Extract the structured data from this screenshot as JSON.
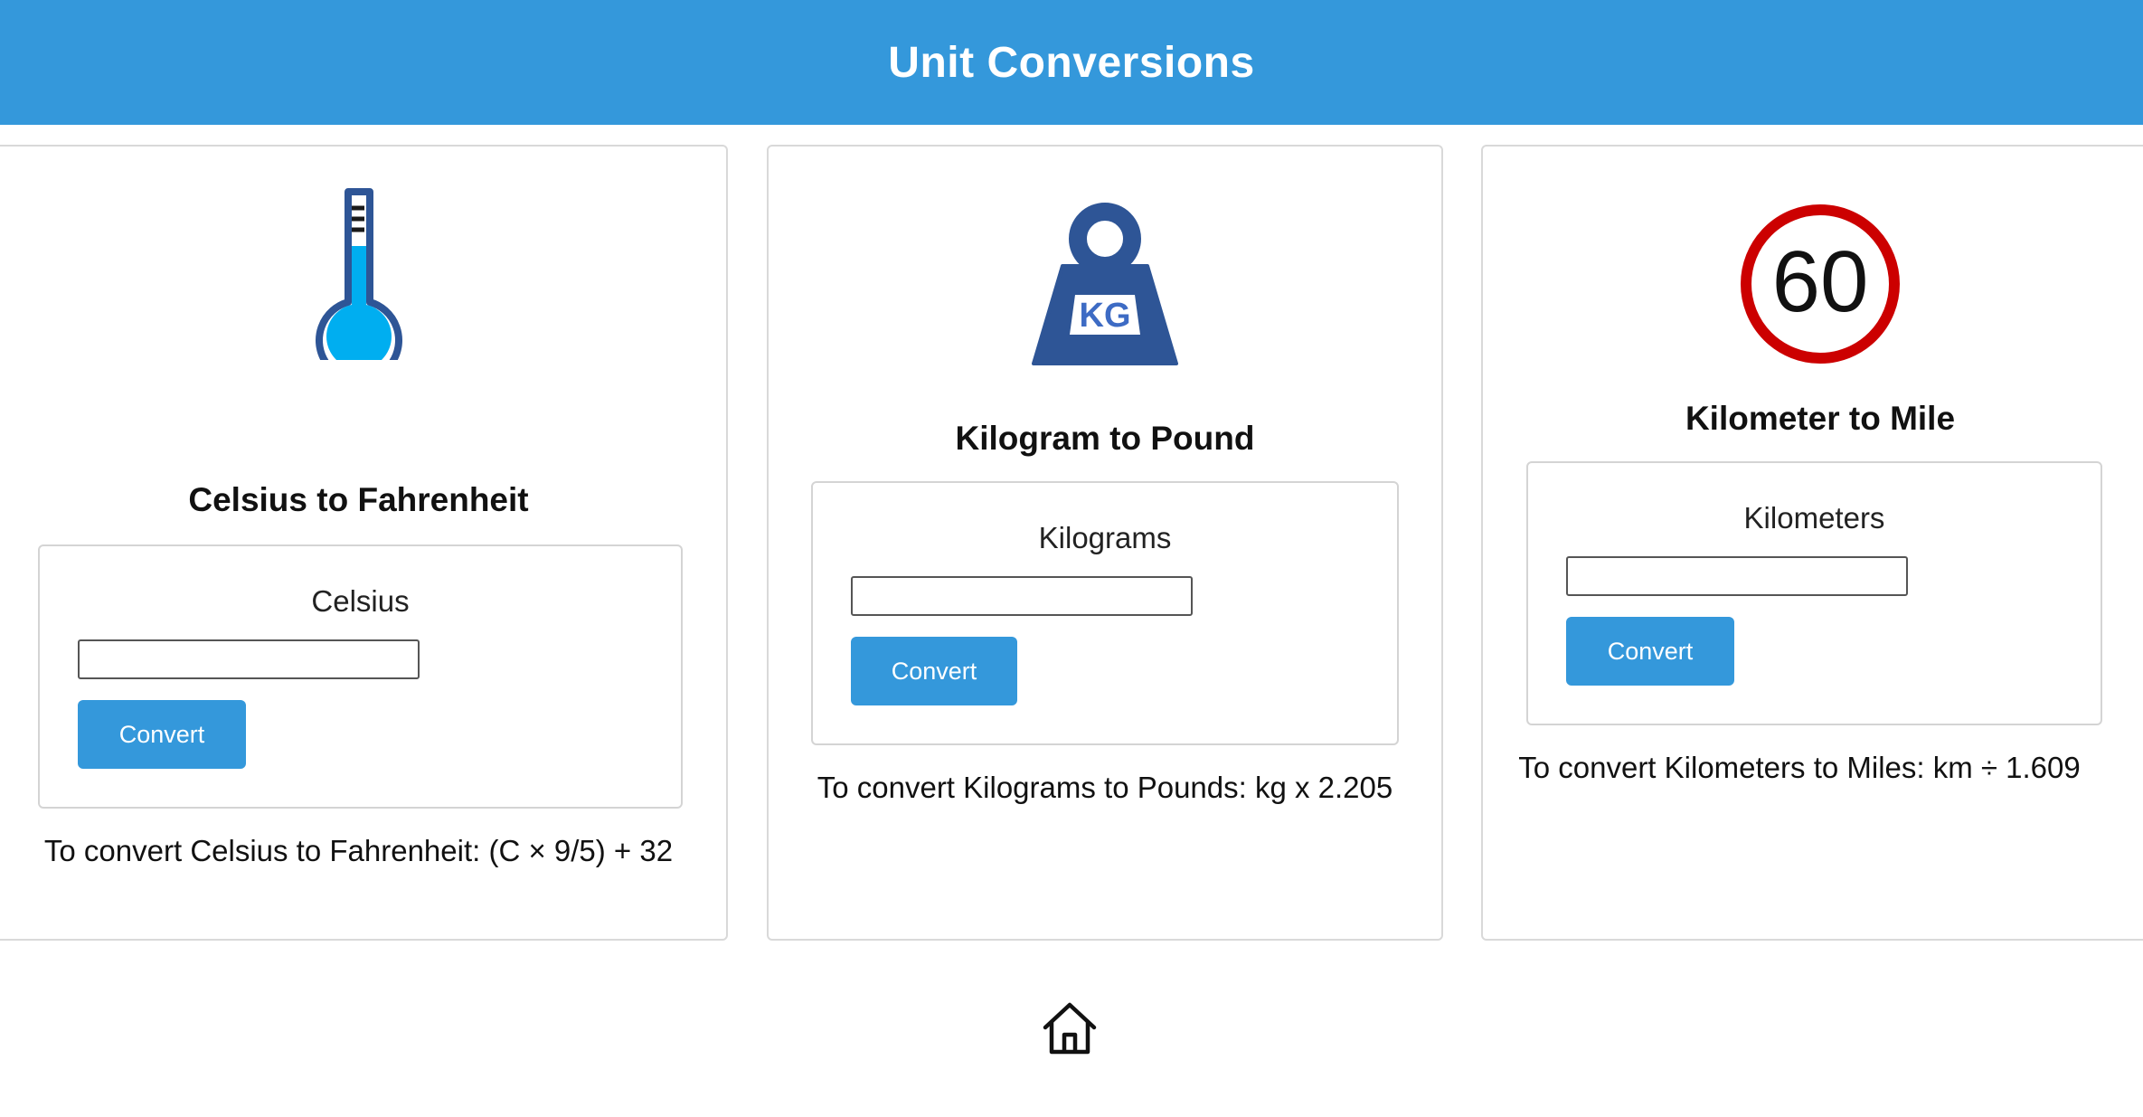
{
  "header": {
    "title": "Unit Conversions",
    "background_color": "#3498db"
  },
  "cards": [
    {
      "icon": "thermometer-icon",
      "title": "Celsius to Fahrenheit",
      "field_label": "Celsius",
      "input_value": "",
      "button_label": "Convert",
      "formula": "To convert Celsius to Fahrenheit: (C × 9/5) + 32"
    },
    {
      "icon": "kg-weight-icon",
      "icon_text": "KG",
      "title": "Kilogram to Pound",
      "field_label": "Kilograms",
      "input_value": "",
      "button_label": "Convert",
      "formula": "To convert Kilograms to Pounds: kg x 2.205"
    },
    {
      "icon": "speed-limit-sign-icon",
      "icon_text": "60",
      "title": "Kilometer to Mile",
      "field_label": "Kilometers",
      "input_value": "",
      "button_label": "Convert",
      "formula": "To convert Kilometers to Miles: km ÷ 1.609"
    }
  ],
  "footer": {
    "home_icon": "home-icon"
  },
  "colors": {
    "accent": "#3498db",
    "thermometer_fill": "#00aef0",
    "icon_dark_blue": "#2e5596",
    "sign_red": "#cc0000"
  }
}
